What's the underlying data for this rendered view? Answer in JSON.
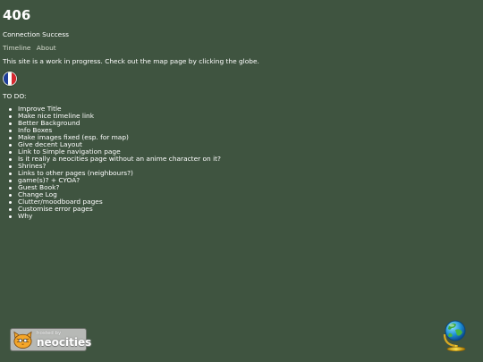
{
  "header": {
    "title": "406",
    "status": "Connection Success"
  },
  "nav": {
    "links": [
      "Timeline",
      "About"
    ]
  },
  "notice": "This site is a work in progress. Check out the map page by clicking the globe.",
  "language_flag": {
    "icon": "french-flag-icon",
    "colors": [
      "#1f3f9a",
      "#ffffff",
      "#d6262e"
    ]
  },
  "todo": {
    "heading": "TO DO:",
    "items": [
      "Improve Title",
      "Make nice timeline link",
      "Better Background",
      "Info Boxes",
      "Make images fixed (esp. for map)",
      "Give decent Layout",
      "Link to Simple navigation page",
      "Is it really a neocities page without an anime character on it?",
      "Shrines?",
      "Links to other pages (neighbours?)",
      "game(s)? + CYOA?",
      "Guest Book?",
      "Change Log",
      "Clutter/moodboard pages",
      "Customise error pages",
      "Why"
    ]
  },
  "footer": {
    "badge_small": "hosted by",
    "badge_big": "neocities",
    "badge_icon": "neocities-cat-icon",
    "globe_icon": "globe-icon"
  },
  "colors": {
    "background": "#3f5440",
    "text": "#ffffff",
    "link": "#d7dccf"
  }
}
